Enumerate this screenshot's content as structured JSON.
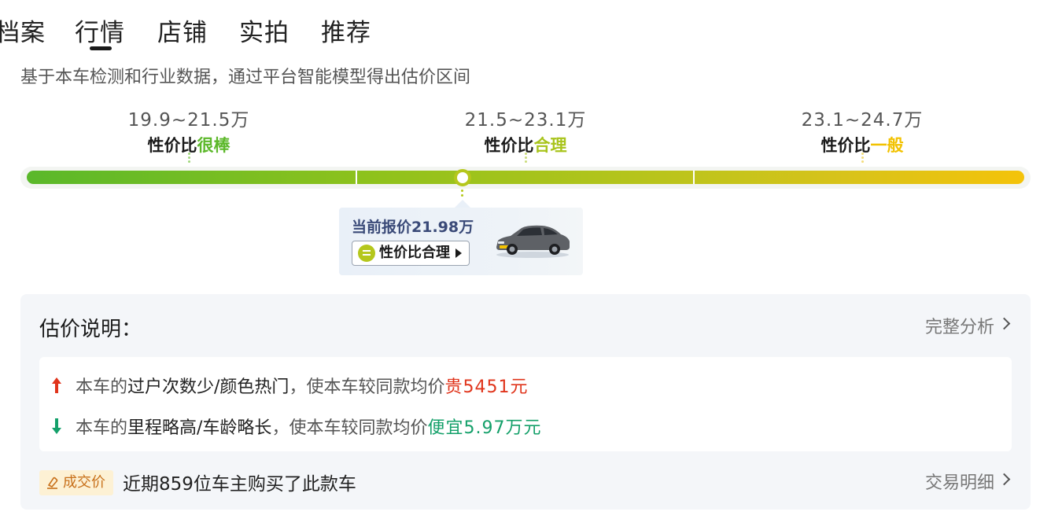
{
  "tabs": [
    {
      "label": "档案"
    },
    {
      "label": "行情"
    },
    {
      "label": "店铺"
    },
    {
      "label": "实拍"
    },
    {
      "label": "推荐"
    }
  ],
  "active_tab": "行情",
  "subtitle": "基于本车检测和行业数据，通过平台智能模型得出估价区间",
  "ranges": [
    {
      "price": "19.9~21.5万",
      "label_prefix": "性价比",
      "label_highlight": "很棒",
      "color": "#5cb82a"
    },
    {
      "price": "21.5~23.1万",
      "label_prefix": "性价比",
      "label_highlight": "合理",
      "color": "#a8c41c"
    },
    {
      "price": "23.1~24.7万",
      "label_prefix": "性价比",
      "label_highlight": "一般",
      "color": "#f2c200"
    }
  ],
  "current": {
    "title": "当前报价21.98万",
    "badge": "性价比合理",
    "position_fraction": 0.437
  },
  "explanation": {
    "title": "估价说明：",
    "link": "完整分析",
    "reasons": [
      {
        "prefix": "本车的",
        "strong": "过户次数少/颜色热门",
        "middle": "，使本车较同款均价",
        "result": "贵5451元",
        "direction": "up",
        "color": "#e0341b"
      },
      {
        "prefix": "本车的",
        "strong": "里程略高/车龄略长",
        "middle": "，使本车较同款均价",
        "result": "便宜5.97万元",
        "direction": "down",
        "color": "#14a06a"
      }
    ]
  },
  "deal": {
    "tag": "成交价",
    "text": "近期859位车主购买了此款车",
    "link": "交易明细"
  },
  "colors": {
    "accent_green": "#5cb82a",
    "accent_fair": "#b5c71c",
    "accent_yellow": "#f4c30a",
    "price_up": "#e0341b",
    "price_down": "#14a06a",
    "card_title": "#3a4a78"
  }
}
